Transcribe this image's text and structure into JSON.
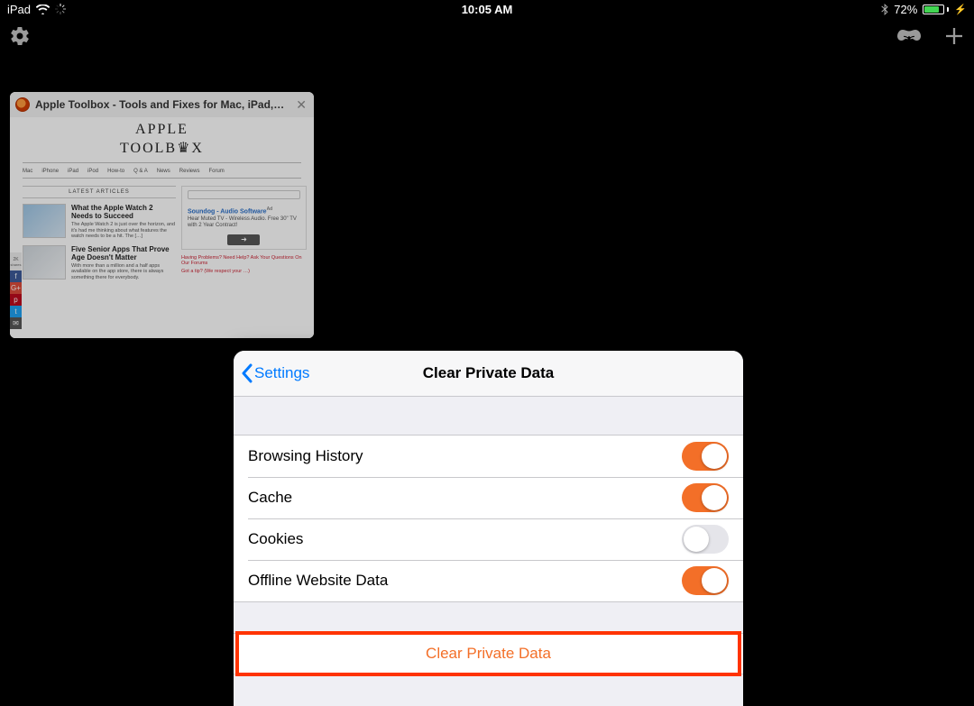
{
  "statusbar": {
    "device": "iPad",
    "time": "10:05 AM",
    "battery_pct": "72%",
    "battery_fill": 72
  },
  "tab": {
    "title": "Apple Toolbox - Tools and Fixes for Mac, iPad,…",
    "brand1": "APPLE",
    "brand2": "TOOLB♛X",
    "menu": [
      "Mac",
      "iPhone",
      "iPad",
      "iPod",
      "How-to",
      "Q & A",
      "News",
      "Reviews",
      "Forum"
    ],
    "latest": "LATEST ARTICLES",
    "articles": [
      {
        "title": "What the Apple Watch 2 Needs to Succeed",
        "excerpt": "The Apple Watch 2 is just over the horizon, and it's had me thinking about what features the watch needs to be a hit. The […]"
      },
      {
        "title": "Five Senior Apps That Prove Age Doesn't Matter",
        "excerpt": "With more than a million and a half apps available on the app store, there is always something there for everybody."
      }
    ],
    "ad": {
      "title": "Soundog - Audio Software",
      "sup": "Ad",
      "text": "Hear Muted TV - Wireless Audio. Free 30\" TV with 2 Year Contract!",
      "btn": "➜"
    },
    "note1": "Having Problems? Need Help? Ask Your Questions On Our Forums",
    "note2": "Got a tip? (We respect your …)",
    "share_count": "2K",
    "share_label": "shares"
  },
  "modal": {
    "back": "Settings",
    "title": "Clear Private Data",
    "rows": [
      {
        "label": "Browsing History",
        "on": true
      },
      {
        "label": "Cache",
        "on": true
      },
      {
        "label": "Cookies",
        "on": false
      },
      {
        "label": "Offline Website Data",
        "on": true
      }
    ],
    "action": "Clear Private Data"
  }
}
